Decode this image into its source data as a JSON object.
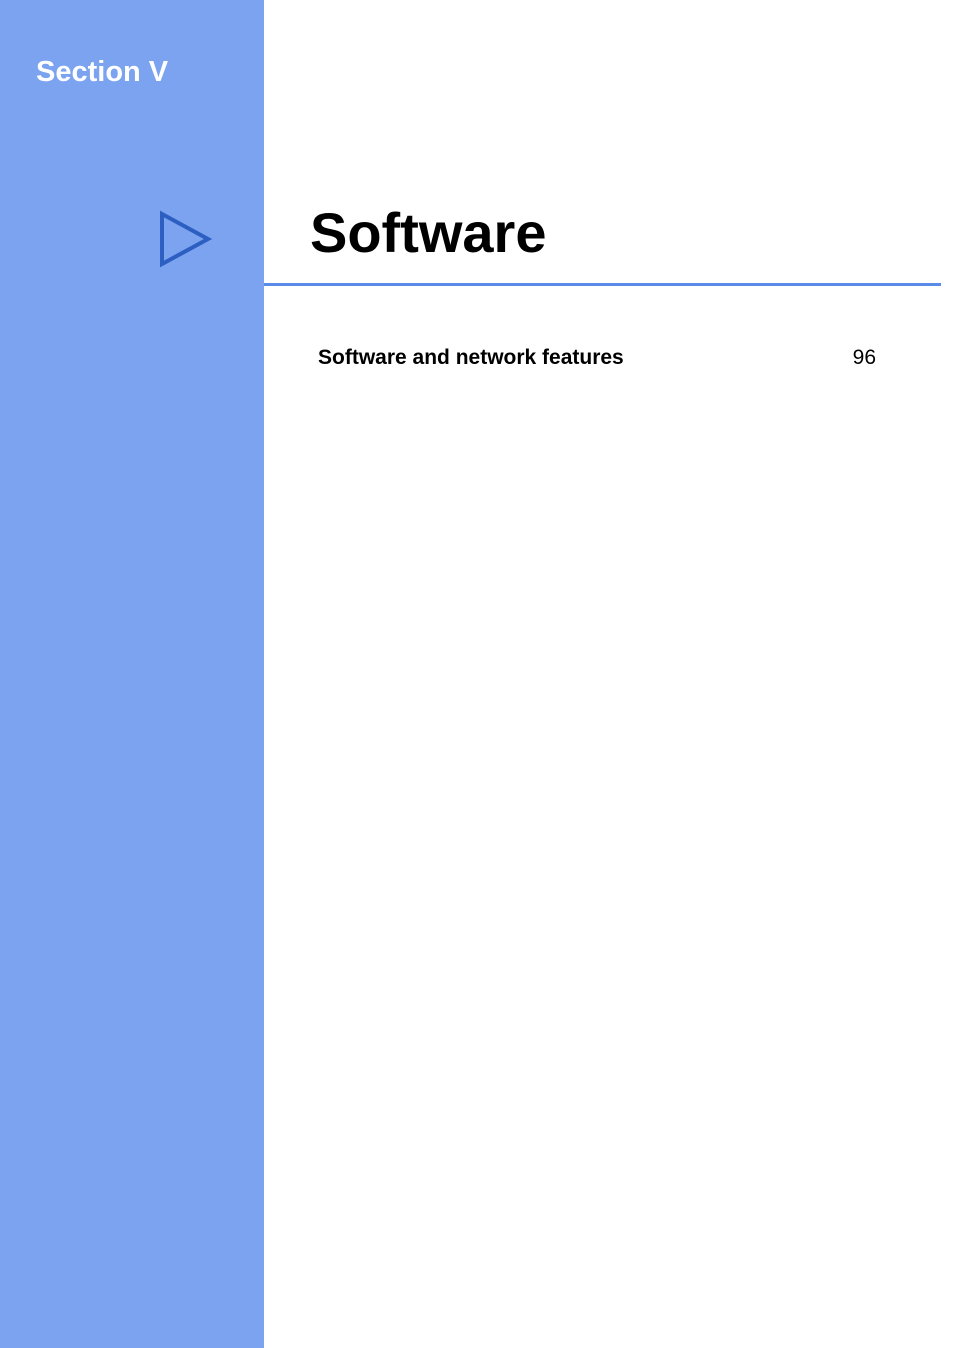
{
  "section_label": "Section V",
  "main_title": "Software",
  "toc": {
    "entry_label": "Software and network features",
    "page_number": "96"
  },
  "colors": {
    "sidebar": "#7ba3ef",
    "underline": "#5b8be8",
    "triangle": "#2c5fc1"
  }
}
